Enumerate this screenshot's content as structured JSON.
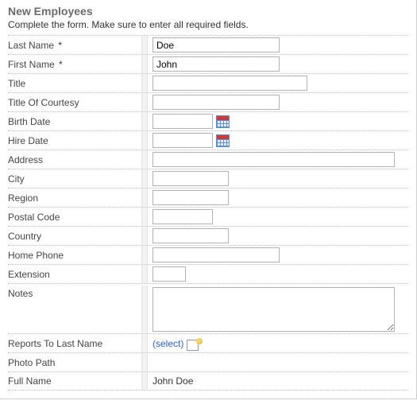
{
  "form": {
    "title": "New Employees",
    "instruction": "Complete the form. Make sure to enter all required fields.",
    "required_mark": "*",
    "fields": {
      "last_name": {
        "label": "Last Name",
        "value": "Doe"
      },
      "first_name": {
        "label": "First Name",
        "value": "John"
      },
      "title": {
        "label": "Title",
        "value": ""
      },
      "title_courtesy": {
        "label": "Title Of Courtesy",
        "value": ""
      },
      "birth_date": {
        "label": "Birth Date",
        "value": ""
      },
      "hire_date": {
        "label": "Hire Date",
        "value": ""
      },
      "address": {
        "label": "Address",
        "value": ""
      },
      "city": {
        "label": "City",
        "value": ""
      },
      "region": {
        "label": "Region",
        "value": ""
      },
      "postal_code": {
        "label": "Postal Code",
        "value": ""
      },
      "country": {
        "label": "Country",
        "value": ""
      },
      "home_phone": {
        "label": "Home Phone",
        "value": ""
      },
      "extension": {
        "label": "Extension",
        "value": ""
      },
      "notes": {
        "label": "Notes",
        "value": ""
      },
      "reports_to": {
        "label": "Reports To Last Name",
        "select_text": "(select)"
      },
      "photo_path": {
        "label": "Photo Path",
        "value": ""
      },
      "full_name": {
        "label": "Full Name",
        "value": "John Doe"
      }
    }
  }
}
